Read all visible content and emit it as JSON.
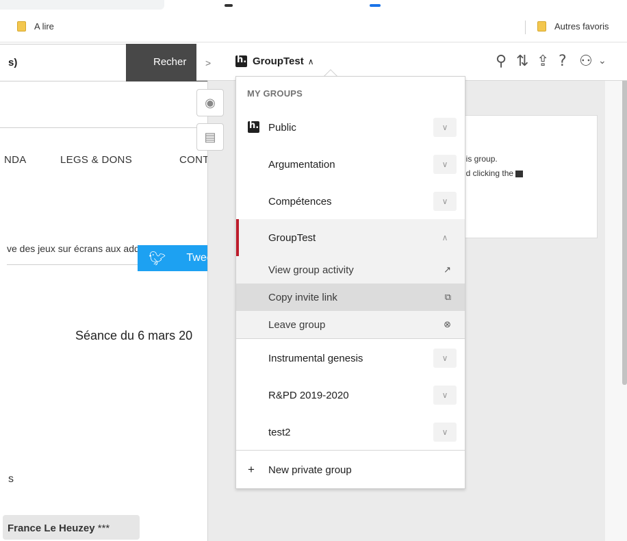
{
  "bookmarks": {
    "left": {
      "label": "A lire"
    },
    "right": {
      "label": "Autres favoris"
    }
  },
  "site": {
    "search_value": "s)",
    "search_button": "Recher",
    "nav": [
      "NDA",
      "LEGS & DONS",
      "CONTAC"
    ],
    "breadcrumb": "ve des jeux sur écrans aux addictions",
    "tweet_label": "Tweet",
    "seance": "Séance du 6 mars 20",
    "small_text": "s",
    "author_name": "France Le Heuzey",
    "author_stars": "***"
  },
  "sidebar": {
    "collapse_icon": "chevron-right-icon",
    "current_group": "GroupTest",
    "toolbar_icons": [
      "search-icon",
      "sort-icon",
      "share-icon",
      "help-icon",
      "user-icon"
    ],
    "card_lines": [
      "his group.",
      "nd clicking the"
    ]
  },
  "dropdown": {
    "section_title": "MY GROUPS",
    "groups": [
      {
        "name": "Public",
        "has_logo": true
      },
      {
        "name": "Argumentation"
      },
      {
        "name": "Compétences"
      },
      {
        "name": "GroupTest",
        "active": true
      },
      {
        "name": "Instrumental genesis"
      },
      {
        "name": "R&PD 2019-2020"
      },
      {
        "name": "test2"
      }
    ],
    "actions": [
      {
        "label": "View group activity",
        "icon": "↗"
      },
      {
        "label": "Copy invite link",
        "icon": "⧉"
      },
      {
        "label": "Leave group",
        "icon": "⊗"
      }
    ],
    "new_group": "New private group"
  },
  "colors": {
    "active_bar": "#bd1c2b",
    "tweet": "#1da1f2",
    "search_button": "#484848"
  }
}
